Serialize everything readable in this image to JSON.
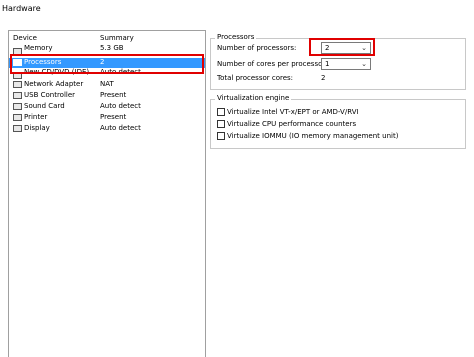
{
  "window": {
    "title": "Hardware"
  },
  "device_list": {
    "columns": {
      "device": "Device",
      "summary": "Summary"
    },
    "rows": [
      {
        "name": "Memory",
        "summary": "5.3 GB",
        "icon": "memory-icon"
      },
      {
        "name": "Processors",
        "summary": "2",
        "icon": "processor-icon",
        "selected": true
      },
      {
        "name": "New CD/DVD (IDE)",
        "summary": "Auto detect",
        "icon": "cd-dvd-icon"
      },
      {
        "name": "Network Adapter",
        "summary": "NAT",
        "icon": "network-adapter-icon"
      },
      {
        "name": "USB Controller",
        "summary": "Present",
        "icon": "usb-controller-icon"
      },
      {
        "name": "Sound Card",
        "summary": "Auto detect",
        "icon": "sound-card-icon"
      },
      {
        "name": "Printer",
        "summary": "Present",
        "icon": "printer-icon"
      },
      {
        "name": "Display",
        "summary": "Auto detect",
        "icon": "display-icon"
      }
    ]
  },
  "processors": {
    "group_title": "Processors",
    "num_processors_label": "Number of processors:",
    "num_processors_value": "2",
    "cores_label": "Number of cores per processor:",
    "cores_value": "1",
    "total_label": "Total processor cores:",
    "total_value": "2"
  },
  "virtualization": {
    "group_title": "Virtualization engine",
    "options": [
      {
        "label": "Virtualize Intel VT-x/EPT or AMD-V/RVI",
        "checked": false
      },
      {
        "label": "Virtualize CPU performance counters",
        "checked": false
      },
      {
        "label": "Virtualize IOMMU (IO memory management unit)",
        "checked": false
      }
    ]
  },
  "colors": {
    "highlight": "#e00000",
    "selection": "#3399ff"
  }
}
